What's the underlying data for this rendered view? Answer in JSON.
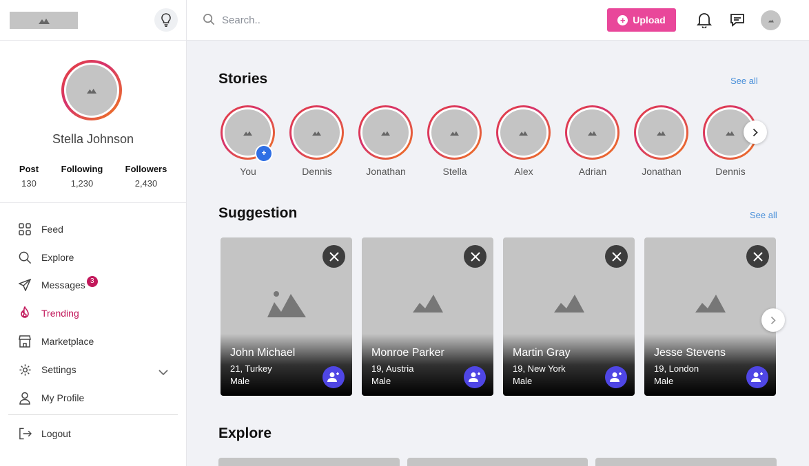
{
  "search": {
    "placeholder": "Search.."
  },
  "header": {
    "upload_label": "Upload"
  },
  "profile": {
    "name": "Stella Johnson"
  },
  "stats": [
    {
      "label": "Post",
      "value": "130"
    },
    {
      "label": "Following",
      "value": "1,230"
    },
    {
      "label": "Followers",
      "value": "2,430"
    }
  ],
  "menu": [
    {
      "label": "Feed",
      "icon": "grid-icon"
    },
    {
      "label": "Explore",
      "icon": "search-icon"
    },
    {
      "label": "Messages",
      "icon": "send-icon",
      "badge": "3"
    },
    {
      "label": "Trending",
      "icon": "flame-icon"
    },
    {
      "label": "Marketplace",
      "icon": "store-icon"
    },
    {
      "label": "Settings",
      "icon": "gear-icon"
    },
    {
      "label": "My Profile",
      "icon": "user-icon"
    },
    {
      "label": "Logout",
      "icon": "logout-icon"
    }
  ],
  "stories": {
    "title": "Stories",
    "see_all": "See all",
    "items": [
      "You",
      "Dennis",
      "Jonathan",
      "Stella",
      "Alex",
      "Adrian",
      "Jonathan",
      "Dennis"
    ]
  },
  "suggestion": {
    "title": "Suggestion",
    "see_all": "See all",
    "cards": [
      {
        "name": "John Michael",
        "location": "21, Turkey",
        "gender": "Male"
      },
      {
        "name": "Monroe Parker",
        "location": "19, Austria",
        "gender": "Male"
      },
      {
        "name": "Martin Gray",
        "location": "19, New York",
        "gender": "Male"
      },
      {
        "name": "Jesse Stevens",
        "location": "19, London",
        "gender": "Male"
      }
    ]
  },
  "explore": {
    "title": "Explore"
  },
  "colors": {
    "accent": "#e9479a",
    "active": "#c2185b",
    "link": "#4a90d9",
    "follow": "#4f46e5"
  }
}
